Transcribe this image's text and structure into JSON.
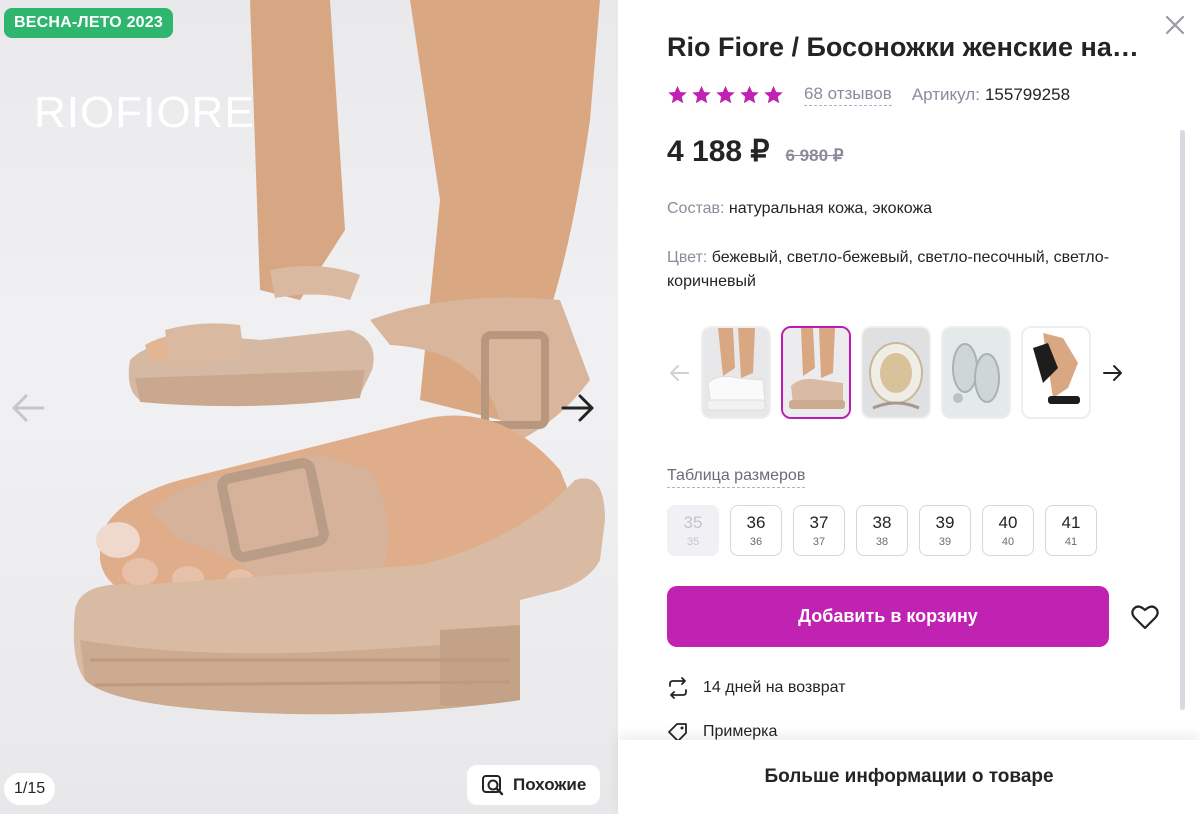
{
  "gallery": {
    "badge": "ВЕСНА-ЛЕТО 2023",
    "logo": "RIOFIORE",
    "counter": "1/15",
    "similar_label": "Похожие"
  },
  "product": {
    "title": "Rio Fiore / Босоножки женские натуральная кожа",
    "rating_stars": 5,
    "reviews": "68 отзывов",
    "article_label": "Артикул:",
    "article_value": "155799258",
    "price": "4 188 ₽",
    "old_price": "6 980 ₽",
    "composition_label": "Состав:",
    "composition_value": "натуральная кожа, экокожа",
    "color_label": "Цвет:",
    "color_value": "бежевый, светло-бежевый, светло-песочный, светло-коричневый"
  },
  "size_table_label": "Таблица размеров",
  "sizes": [
    {
      "big": "35",
      "small": "35",
      "available": false
    },
    {
      "big": "36",
      "small": "36",
      "available": true
    },
    {
      "big": "37",
      "small": "37",
      "available": true
    },
    {
      "big": "38",
      "small": "38",
      "available": true
    },
    {
      "big": "39",
      "small": "39",
      "available": true
    },
    {
      "big": "40",
      "small": "40",
      "available": true
    },
    {
      "big": "41",
      "small": "41",
      "available": true
    }
  ],
  "add_to_cart": "Добавить в корзину",
  "return_info": "14 дней на возврат",
  "fitting_info": "Примерка",
  "more_info": "Больше информации о товаре",
  "colors": {
    "accent": "#c023b1",
    "star": "#c023b1",
    "badge": "#2eb66f"
  }
}
